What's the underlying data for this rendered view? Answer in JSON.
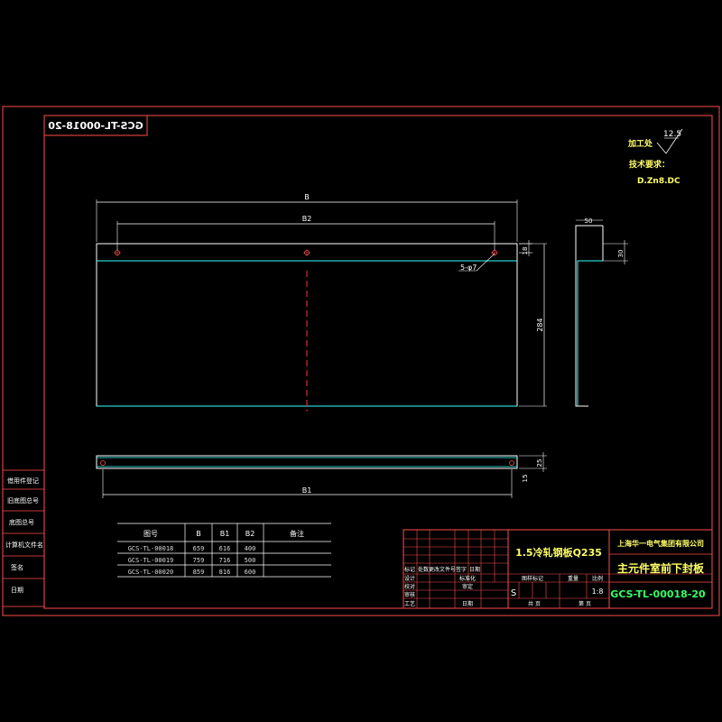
{
  "drawing_code_mirrored": "GCS-TL-00018-20",
  "process": {
    "label": "加工处",
    "roughness": "12.5",
    "tech_req_label": "技术要求：",
    "tech_req_value": "D.Zn8.DC"
  },
  "dims": {
    "B": "B",
    "B2": "B2",
    "B1": "B1",
    "hole_spec": "5-φ7",
    "d18": "18",
    "d284": "284",
    "d50": "50",
    "d30": "30",
    "d25": "25",
    "d15": "15"
  },
  "side_labels": [
    "借用件登记",
    "旧底图总号",
    "底图总号",
    "计算机文件名",
    "签名",
    "日期"
  ],
  "table": {
    "headers": [
      "图号",
      "B",
      "B1",
      "B2",
      "备注"
    ],
    "rows": [
      [
        "GCS-TL-00018",
        "659",
        "616",
        "400",
        ""
      ],
      [
        "GCS-TL-00019",
        "759",
        "716",
        "500",
        ""
      ],
      [
        "GCS-TL-00020",
        "859",
        "816",
        "600",
        ""
      ]
    ]
  },
  "title_block": {
    "material": "1.5冷轧钢板Q235",
    "company": "上海华一电气集团有限公司",
    "part_name": "主元件室前下封板",
    "drawing_no": "GCS-TL-00018-20",
    "scale": "1:8",
    "stage": "S",
    "rows_left": [
      "标记",
      "设计",
      "校对",
      "审核",
      "工艺"
    ],
    "row_labels": [
      "处数",
      "更改文件号",
      "签字",
      "日期"
    ],
    "mid_labels": [
      "标准化",
      "审定",
      "日期"
    ],
    "stage_label": "图样标记",
    "weight_label": "重量",
    "scale_label": "比例",
    "sheet_total": "共 页",
    "sheet_no": "第 页"
  }
}
